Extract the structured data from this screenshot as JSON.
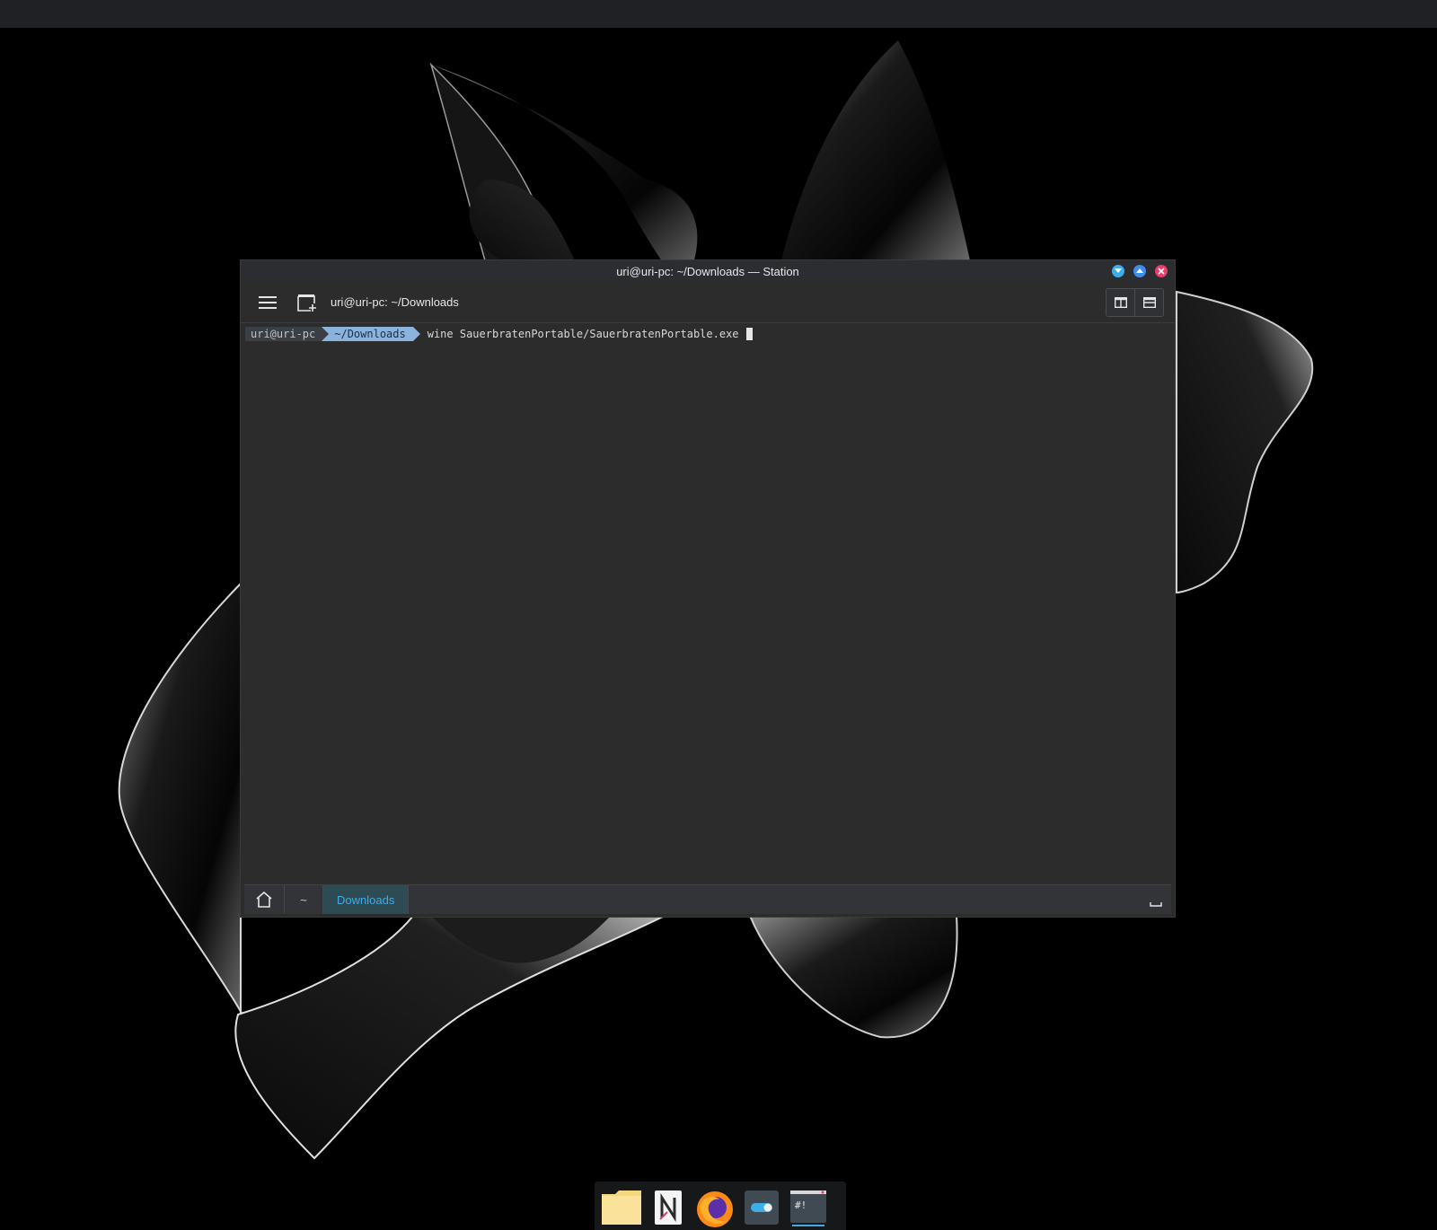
{
  "window": {
    "title": "uri@uri-pc: ~/Downloads — Station",
    "wm_buttons": [
      "minimize",
      "maximize",
      "close"
    ],
    "wm_colors": {
      "minimize": "#3daee9",
      "maximize": "#3d8ee9",
      "close": "#e93d6a"
    }
  },
  "toolbar": {
    "menu_icon": "hamburger-menu-icon",
    "new_tab_icon": "new-tab-icon",
    "title": "uri@uri-pc: ~/Downloads",
    "view_buttons": [
      "split-view-icon",
      "single-view-icon"
    ]
  },
  "terminal": {
    "prompt_user": "uri@uri-pc",
    "prompt_dir": "~/Downloads",
    "command": "wine SauerbratenPortable/SauerbratenPortable.exe",
    "colors": {
      "user_bg": "#3b3e42",
      "dir_bg": "#8ab4de",
      "background": "#2c2c2c"
    }
  },
  "statusbar": {
    "home_icon": "home-icon",
    "crumbs": [
      "~",
      "Downloads"
    ],
    "active_crumb": "Downloads",
    "accent": "#3daee9"
  },
  "dock": {
    "apps": [
      "folder-icon",
      "notes-app-icon",
      "firefox-icon",
      "settings-toggle-icon",
      "station-terminal-icon"
    ],
    "active_app": "station-terminal-icon"
  }
}
